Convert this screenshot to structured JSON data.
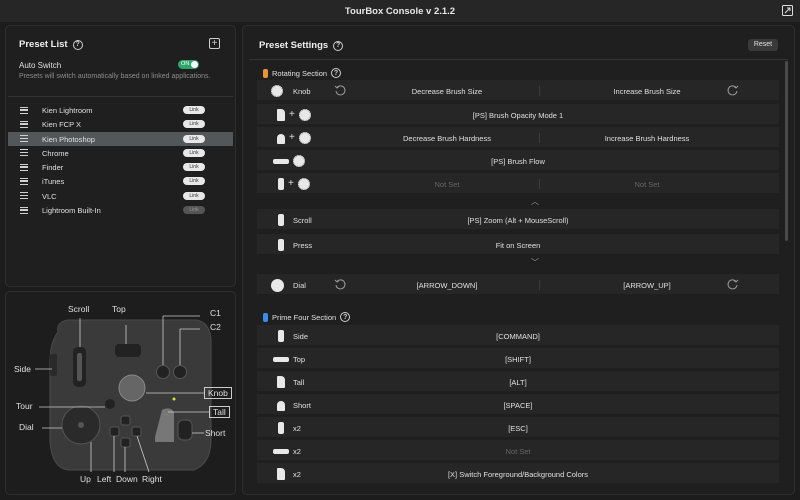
{
  "app": {
    "title": "TourBox Console v 2.1.2"
  },
  "preset_panel": {
    "title": "Preset List",
    "auto_switch_label": "Auto Switch",
    "auto_switch_state": "ON",
    "auto_switch_desc": "Presets will switch automatically based on linked applications.",
    "presets": [
      {
        "name": "Kien Lightroom",
        "link": "Link",
        "active": false
      },
      {
        "name": "Kien FCP X",
        "link": "Link",
        "active": false
      },
      {
        "name": "Kien Photoshop",
        "link": "Link",
        "active": true
      },
      {
        "name": "Chrome",
        "link": "Link",
        "active": false
      },
      {
        "name": "Finder",
        "link": "Link",
        "active": false
      },
      {
        "name": "iTunes",
        "link": "Link",
        "active": false
      },
      {
        "name": "VLC",
        "link": "Link",
        "active": false
      },
      {
        "name": "Lightroom Built-In",
        "link": "Link",
        "active": false
      }
    ]
  },
  "device": {
    "labels": {
      "scroll": "Scroll",
      "top": "Top",
      "c1": "C1",
      "c2": "C2",
      "side": "Side",
      "knob": "Knob",
      "tour": "Tour",
      "tall": "Tall",
      "dial": "Dial",
      "short": "Short",
      "up": "Up",
      "left": "Left",
      "down": "Down",
      "right": "Right"
    }
  },
  "settings": {
    "title": "Preset Settings",
    "reset_label": "Reset",
    "rotating": {
      "title": "Rotating Section",
      "color": "#e8953a",
      "rows": [
        {
          "control": "Knob",
          "left": "Decrease Brush Size",
          "right": "Increase Brush Size"
        },
        {
          "full": "[PS] Brush Opacity Mode 1"
        },
        {
          "left": "Decrease Brush Hardness",
          "right": "Increase Brush Hardness"
        },
        {
          "full": "[PS] Brush Flow"
        },
        {
          "left": "Not Set",
          "right": "Not Set"
        }
      ]
    },
    "scroll": {
      "rows": [
        {
          "control": "Scroll",
          "full": "[PS] Zoom (Alt + MouseScroll)"
        },
        {
          "control": "Press",
          "full": "Fit on Screen"
        }
      ]
    },
    "dial": {
      "rows": [
        {
          "control": "Dial",
          "left": "[ARROW_DOWN]",
          "right": "[ARROW_UP]"
        }
      ]
    },
    "prime_four": {
      "title": "Prime Four Section",
      "color": "#3a8ee8",
      "rows": [
        {
          "control": "Side",
          "value": "[COMMAND]"
        },
        {
          "control": "Top",
          "value": "[SHIFT]"
        },
        {
          "control": "Tall",
          "value": "[ALT]"
        },
        {
          "control": "Short",
          "value": "[SPACE]"
        },
        {
          "control": "x2",
          "value": "[ESC]"
        },
        {
          "control": "x2",
          "value": "Not Set"
        },
        {
          "control": "x2",
          "value": "[X] Switch Foreground/Background Colors"
        }
      ]
    }
  }
}
